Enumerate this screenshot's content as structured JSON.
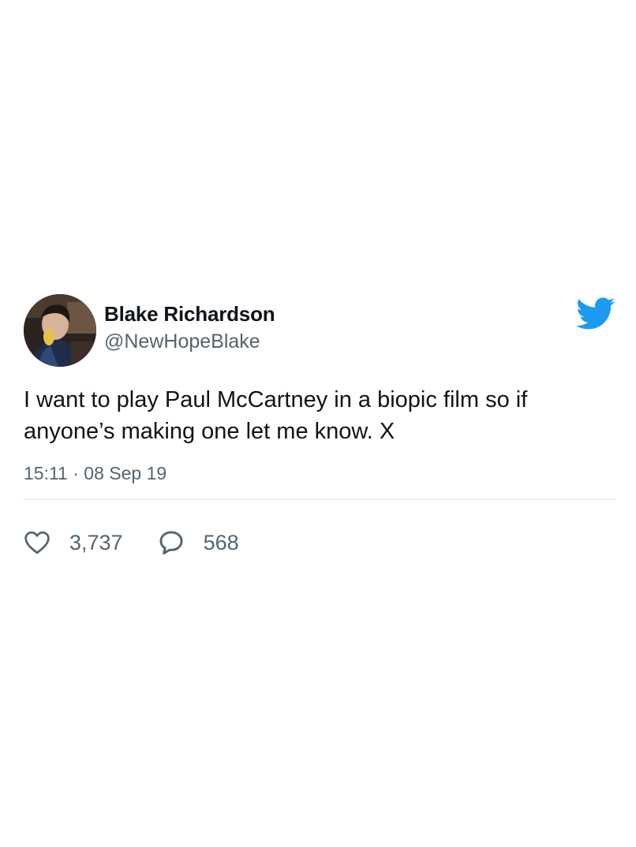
{
  "tweet": {
    "author": {
      "display_name": "Blake Richardson",
      "handle": "@NewHopeBlake"
    },
    "text": "I want to play Paul McCartney in a biopic film so if anyone’s making one let me know. X",
    "timestamp": "15:11 · 08 Sep 19",
    "likes": "3,737",
    "replies": "568"
  },
  "icons": {
    "brand": "twitter-bird-icon",
    "like": "heart-icon",
    "reply": "speech-bubble-icon"
  },
  "colors": {
    "brand_blue": "#1d9bf0",
    "secondary_text": "#536471",
    "primary_text": "#0f1419"
  }
}
